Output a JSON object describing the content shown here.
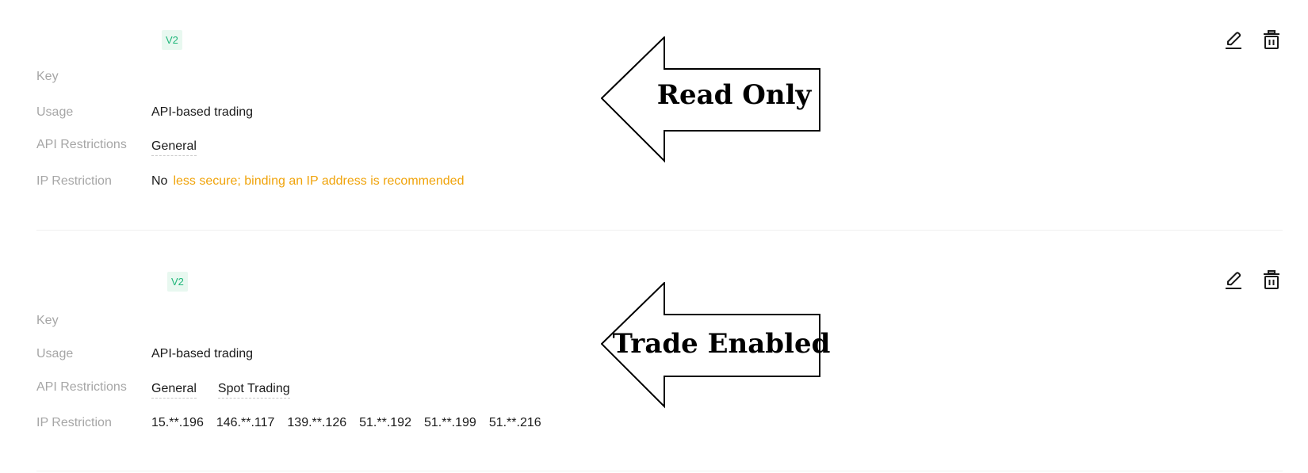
{
  "api_keys": [
    {
      "version_badge": "V2",
      "key_label": "Key",
      "usage_label": "Usage",
      "usage_value": "API-based trading",
      "restrictions_label": "API Restrictions",
      "restrictions": [
        "General"
      ],
      "ip_label": "IP Restriction",
      "ip_value": "No",
      "ip_warning": "less secure; binding an IP address is recommended",
      "annotation": "Read Only"
    },
    {
      "version_badge": "V2",
      "key_label": "Key",
      "usage_label": "Usage",
      "usage_value": "API-based trading",
      "restrictions_label": "API Restrictions",
      "restrictions": [
        "General",
        "Spot Trading"
      ],
      "ip_label": "IP Restriction",
      "ip_addresses": [
        "15.**.196",
        "146.**.117",
        "139.**.126",
        "51.**.192",
        "51.**.199",
        "51.**.216"
      ],
      "annotation": "Trade Enabled"
    }
  ],
  "icons": {
    "edit": "pencil-icon",
    "delete": "trash-icon"
  },
  "colors": {
    "badge_text": "#1fb67a",
    "badge_bg": "#e8f8f0",
    "warning": "#f0a30a",
    "label": "#a6a6a6"
  }
}
